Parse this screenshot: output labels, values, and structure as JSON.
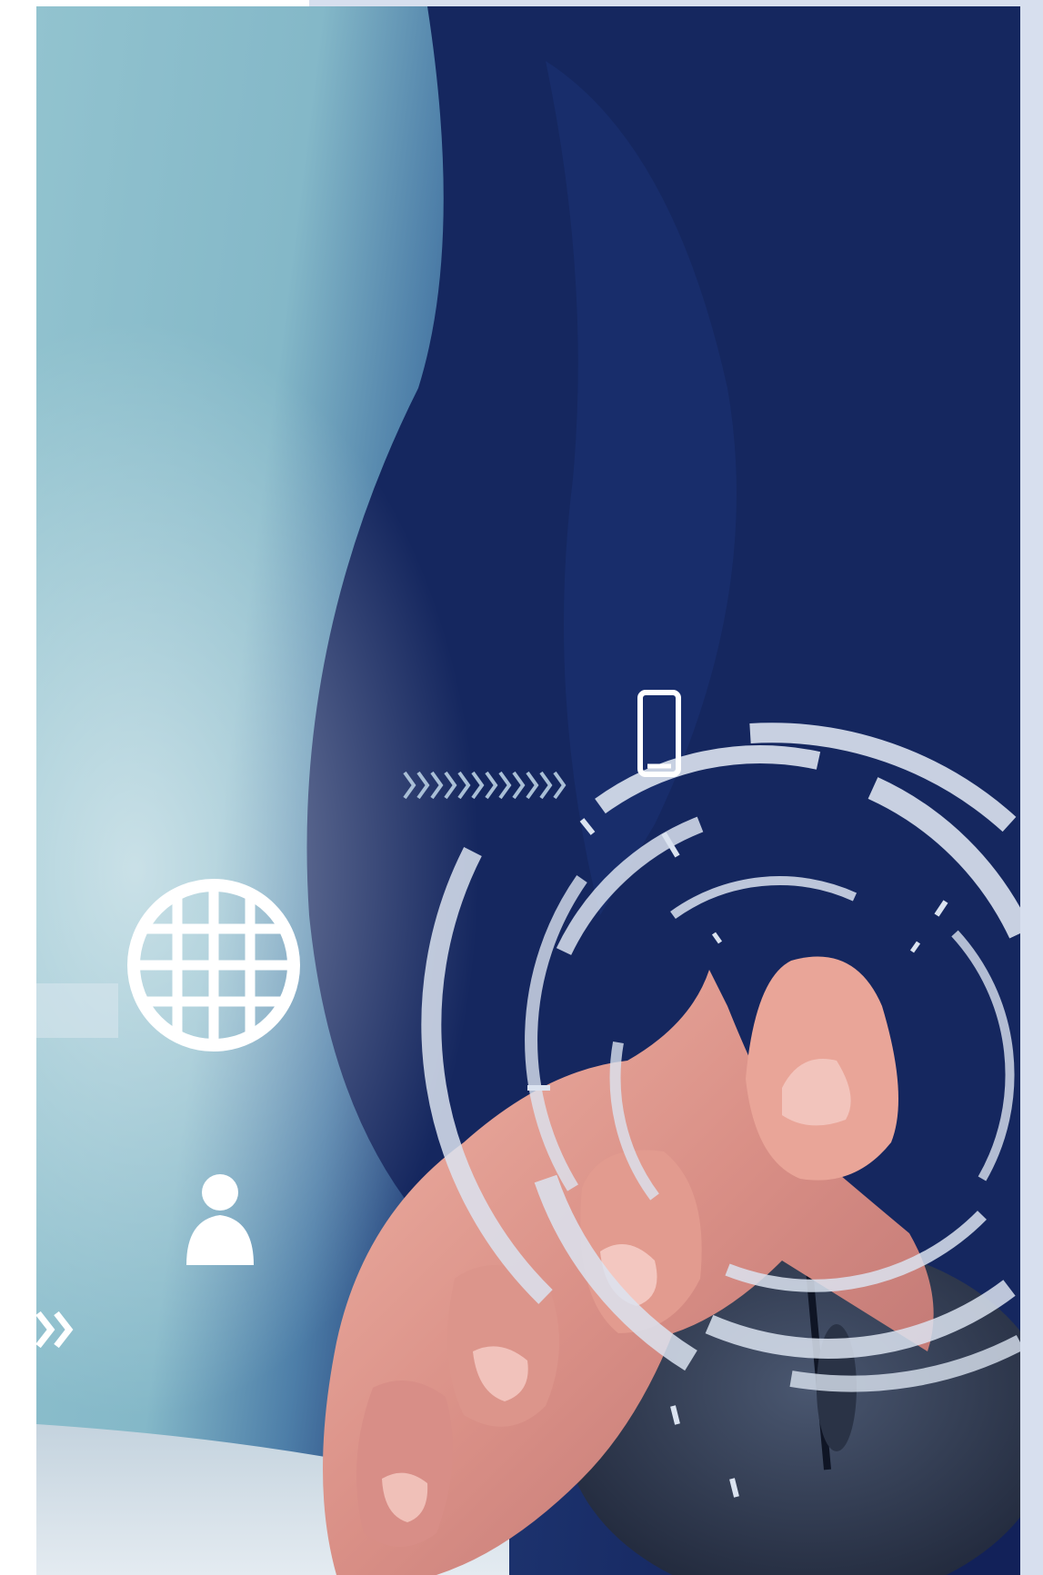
{
  "image": {
    "alt": "",
    "icons": [
      "smartphone-icon",
      "globe-icon",
      "user-icon",
      "chevrons-icon"
    ],
    "colors": {
      "background": "#d7dfee",
      "teal": "#8dbfcc",
      "navy": "#13245c",
      "overlay": "#d9e2f0",
      "skin": "#e8a79a"
    }
  }
}
